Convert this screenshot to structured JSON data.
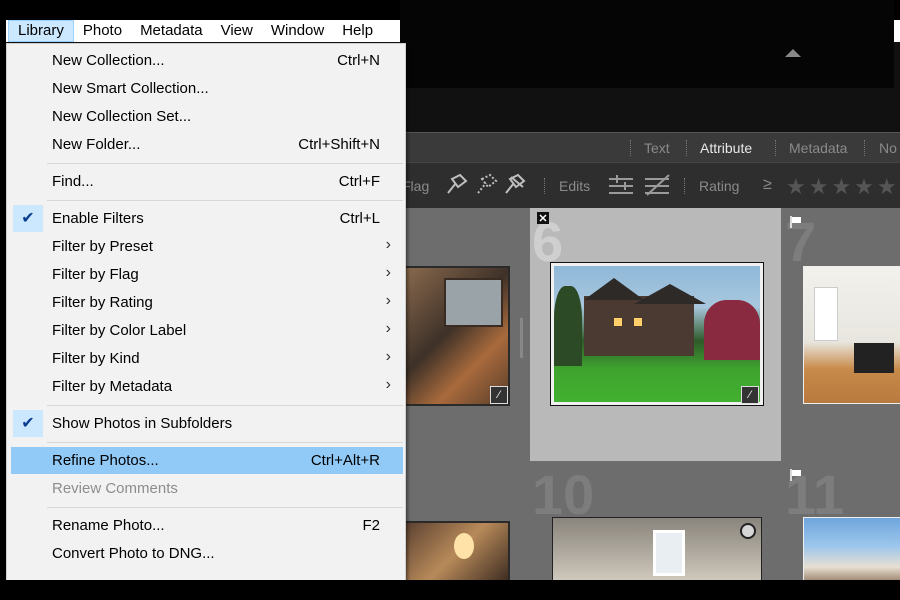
{
  "menubar": {
    "items": [
      "Library",
      "Photo",
      "Metadata",
      "View",
      "Window",
      "Help"
    ]
  },
  "filter_bar": {
    "tabs": [
      "Text",
      "Attribute",
      "Metadata",
      "No"
    ],
    "flag_label": "Flag",
    "edits_label": "Edits",
    "rating_label": "Rating",
    "rating_op": "≥",
    "stars": "★★★★★"
  },
  "grid": {
    "cells": [
      {
        "num": "6"
      },
      {
        "num": "7"
      },
      {
        "num": "10"
      },
      {
        "num": "11"
      }
    ]
  },
  "library_menu": {
    "new_collection": {
      "label": "New Collection...",
      "shortcut": "Ctrl+N"
    },
    "new_smart_collection": {
      "label": "New Smart Collection..."
    },
    "new_collection_set": {
      "label": "New Collection Set..."
    },
    "new_folder": {
      "label": "New Folder...",
      "shortcut": "Ctrl+Shift+N"
    },
    "find": {
      "label": "Find...",
      "shortcut": "Ctrl+F"
    },
    "enable_filters": {
      "label": "Enable Filters",
      "shortcut": "Ctrl+L",
      "checked": true
    },
    "filter_by_preset": {
      "label": "Filter by Preset"
    },
    "filter_by_flag": {
      "label": "Filter by Flag"
    },
    "filter_by_rating": {
      "label": "Filter by Rating"
    },
    "filter_by_color_label": {
      "label": "Filter by Color Label"
    },
    "filter_by_kind": {
      "label": "Filter by Kind"
    },
    "filter_by_metadata": {
      "label": "Filter by Metadata"
    },
    "show_photos_in_subfolders": {
      "label": "Show Photos in Subfolders",
      "checked": true
    },
    "refine_photos": {
      "label": "Refine Photos...",
      "shortcut": "Ctrl+Alt+R"
    },
    "review_comments": {
      "label": "Review Comments",
      "disabled": true
    },
    "rename_photo": {
      "label": "Rename Photo...",
      "shortcut": "F2"
    },
    "convert_photo_to_dng": {
      "label": "Convert Photo to DNG..."
    },
    "submenu_arrow": "›",
    "check_glyph": "✔"
  },
  "colors": {
    "menu_bg": "#f2f2f2",
    "highlight": "#91c9f7",
    "check_bg": "#cce8ff"
  }
}
